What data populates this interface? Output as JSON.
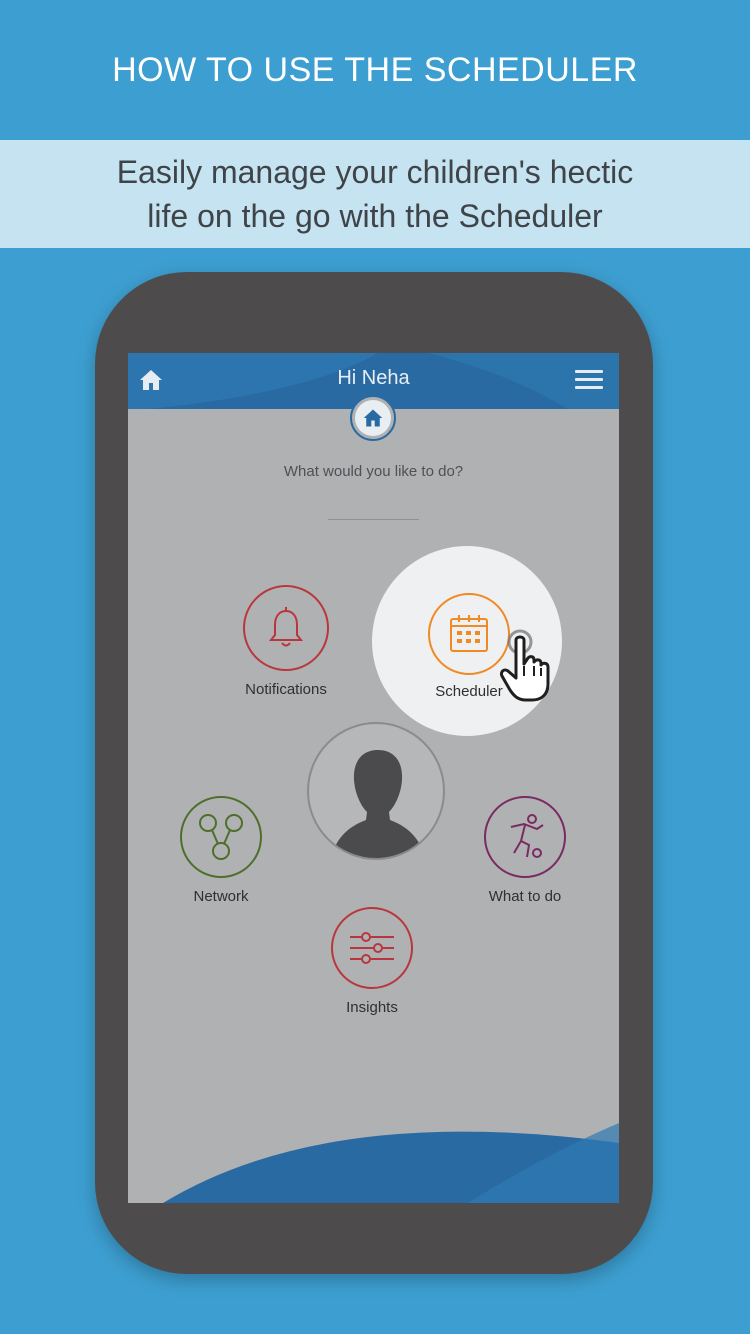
{
  "promo": {
    "title": "HOW TO USE THE SCHEDULER",
    "subtitle_line1": "Easily manage your children's hectic",
    "subtitle_line2": "life on the go with the Scheduler"
  },
  "app": {
    "greeting": "Hi Neha",
    "prompt": "What would you like to do?",
    "menu": {
      "notifications": {
        "label": "Notifications",
        "icon": "bell-icon",
        "color": "#b9373c"
      },
      "scheduler": {
        "label": "Scheduler",
        "icon": "calendar-icon",
        "color": "#f08a24"
      },
      "network": {
        "label": "Network",
        "icon": "network-icon",
        "color": "#4f6d2b"
      },
      "what_to_do": {
        "label": "What to do",
        "icon": "soccer-player-icon",
        "color": "#7a2a63"
      },
      "insights": {
        "label": "Insights",
        "icon": "sliders-icon",
        "color": "#b9373c"
      }
    }
  },
  "colors": {
    "background": "#3d9fd1",
    "subtitle_band": "#c6e3f1",
    "device": "#4e4b4c",
    "appbar": "#2a6aa3",
    "screen": "#b0b1b3"
  }
}
